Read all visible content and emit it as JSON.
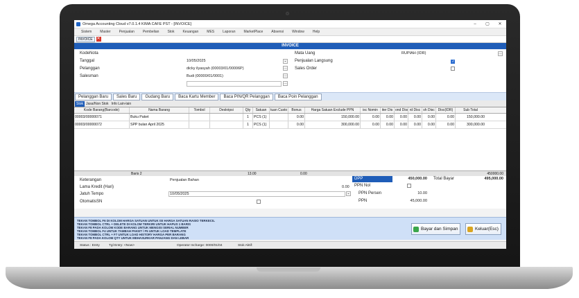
{
  "window": {
    "title": "Omega Accounting Cloud v7.0.1.4 KIMA CAFE PST - [INVOICE]",
    "min_glyph": "–",
    "max_glyph": "▢",
    "close_glyph": "✕"
  },
  "menu": [
    "Sistem",
    "Master",
    "Penjualan",
    "Pembelian",
    "Stok",
    "Keuangan",
    "MES",
    "Laporan",
    "MarketPlace",
    "Absensi",
    "Window",
    "Help"
  ],
  "doc_tab": {
    "label": "INVOICE",
    "close_glyph": "✕"
  },
  "header": {
    "title": "INVOICE"
  },
  "form": {
    "kodenota_label": "KodeNota",
    "tanggal_label": "Tanggal",
    "tanggal_value": "10/05/2025",
    "pelanggan_label": "Pelanggan",
    "pelanggan_value": "dicky ilyasyah (00003/01/00006P)",
    "salesman_label": "Salesman",
    "salesman_value": "Budi (00000/01/0001)",
    "mata_uang_label": "Mata Uang",
    "mata_uang_value": "RUPIAH (IDR)",
    "penjualan_langsung_label": "Penjualan Langsung",
    "penjualan_langsung_checked": true,
    "sales_order_label": "Sales Order",
    "sales_order_checked": false
  },
  "action_buttons": [
    "Pelanggan Baru",
    "Sales Baru",
    "Gudang Baru",
    "Baca Kartu Member",
    "Baca PIN/QR Pelanggan",
    "Baca Poin Pelanggan"
  ],
  "sub_tabs": [
    "Stok",
    "Jasa/Non Stok",
    "Info Lain-lain"
  ],
  "grid": {
    "columns": [
      "Kode Barang(Barcode)",
      "Nama Barang",
      "Tombol",
      "Deskripsi",
      "Qty",
      "Satuan",
      "tuan Custo",
      "Bonus",
      "Harga Satuan Exclude PPN",
      "isc Nomin",
      "iter Dis",
      "ond Disc",
      "rd Disc",
      "sh Disc",
      "Disc(IDR)",
      "Sub Total"
    ],
    "rows": [
      [
        "00003/00000071",
        "Buku Paket",
        "",
        "",
        "1",
        "PCS (1)",
        "",
        "0.00",
        "150,000.00",
        "0.00",
        "0.00",
        "0.00",
        "0.00",
        "0.00",
        "0.00",
        "150,000.00"
      ],
      [
        "00003/00000072",
        "SPP bulan April 2025",
        "",
        "",
        "1",
        "PCS (1)",
        "",
        "0.00",
        "300,000.00",
        "0.00",
        "0.00",
        "0.00",
        "0.00",
        "0.00",
        "0.00",
        "300,000.00"
      ]
    ],
    "footer": {
      "rows_label": "Baris 2",
      "qty_total": "13.00",
      "bonus_total": "0.00",
      "grand_total": "450000.00"
    }
  },
  "bottom": {
    "keterangan_label": "Keterangan",
    "keterangan_value": "Penjualan Bahan",
    "lama_kredit_label": "Lama Kredit (Hari)",
    "lama_kredit_value": "0.00",
    "jatuh_tempo_label": "Jatuh Tempo",
    "jatuh_tempo_value": "10/05/2025",
    "otomatis_sn_label": "OtomatisSN",
    "otomatis_sn_checked": false
  },
  "totals": {
    "dpp_label": "DPP",
    "dpp_value": "450,000.00",
    "total_bayar_label": "Total Bayar",
    "total_bayar_value": "495,000.00",
    "ppn_nol_label": "PPN Nol",
    "ppn_nol_checked": false,
    "ppn_persen_label": "PPN Persen",
    "ppn_persen_value": "10.00",
    "ppn_label": "PPN",
    "ppn_value": "45,000.00"
  },
  "info_lines": [
    "TEKAN TOMBOL F6 DI KOLOM HARGA SATUAN UNTUK ISI HARGA SATUAN RASIO TERKECIL",
    "TEKAN TOMBOL CTRL + DELETE DI KOLOM TERKIRI UNTUK HAPUS 1 BARIS",
    "TEKAN F8 PADA KOLOM KODE BARANG UNTUK MENGISI SERIAL NUMBER",
    "TEKAN TOMBOL F4 UNTUK TAMBAH PAKET / F5 UNTUK LOAD TEMPLATE",
    "TEKAN TOMBOL CTRL + F7 UNTUK LOAD HISTORY HARGA PER BARANG",
    "TEKAN F8 PADA KOLOM QTY UNTUK MEHASURKAR PANJANG DAN LEBAR"
  ],
  "buttons": {
    "save_label": "Bayar dan Simpan",
    "exit_label": "Keluar(Esc)"
  },
  "status": {
    "status_text": "Status : Entry",
    "tgl_entry_text": "Tgl Entry: <Now>",
    "operator_text": "Operator Incharge: 0000/01/04",
    "stok_text": "Stok Aktif:"
  },
  "colors": {
    "accent": "#1f5db8",
    "info_bar": "#cfe0f7"
  }
}
